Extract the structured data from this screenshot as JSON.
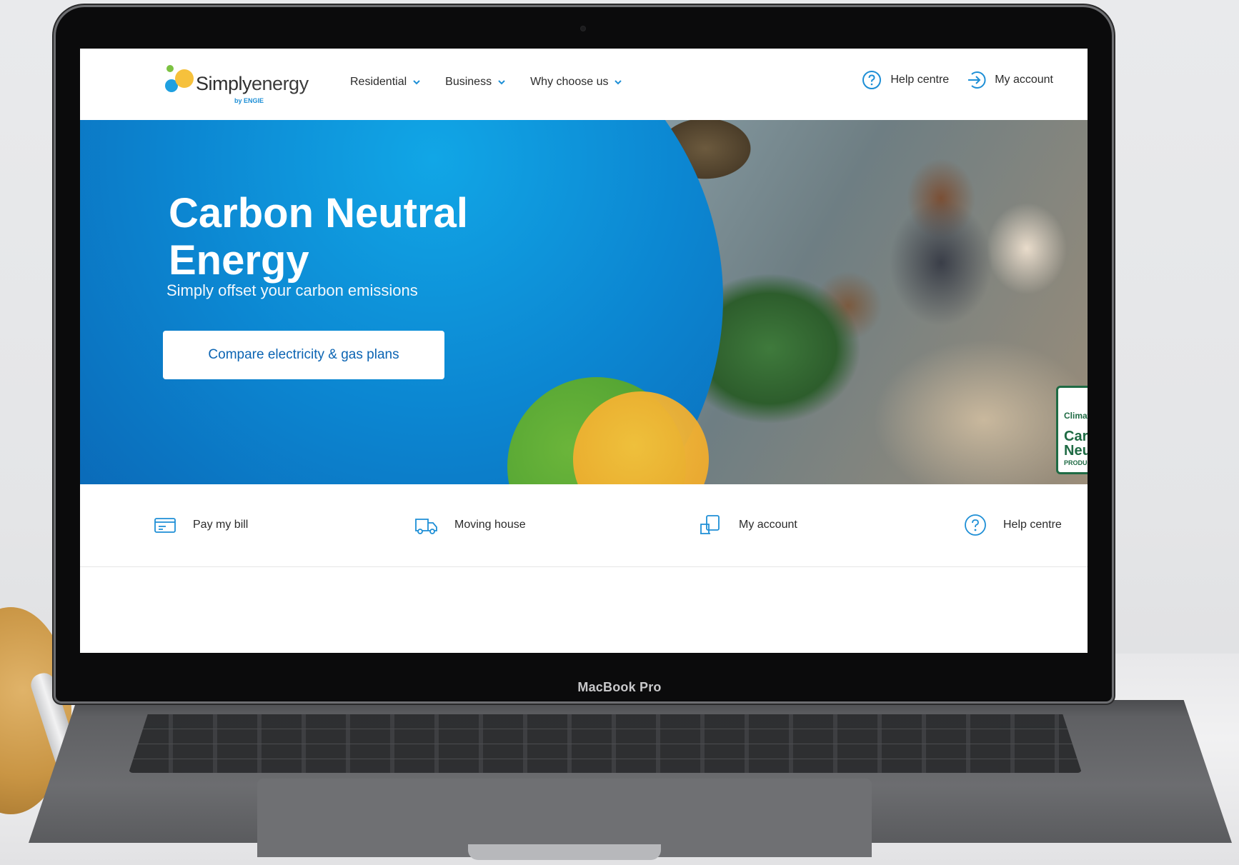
{
  "device": {
    "label": "MacBook Pro"
  },
  "logo": {
    "wordmark_bold": "Simply",
    "wordmark_light": "energy",
    "byline": "by ENGIE"
  },
  "nav": {
    "items": [
      {
        "label": "Residential"
      },
      {
        "label": "Business"
      },
      {
        "label": "Why choose us"
      }
    ]
  },
  "utility": {
    "help_label": "Help centre",
    "account_label": "My account"
  },
  "hero": {
    "title_line1": "Carbon Neutral",
    "title_line2": "Energy",
    "subtitle": "Simply offset your carbon emissions",
    "cta_label": "Compare electricity & gas plans",
    "badge": {
      "line1": "Climate",
      "line2": "Carb",
      "line3": "Neu",
      "line4": "PRODUC"
    }
  },
  "quick_links": [
    {
      "label": "Pay my bill",
      "icon": "bill-icon"
    },
    {
      "label": "Moving house",
      "icon": "truck-icon"
    },
    {
      "label": "My account",
      "icon": "laptop-icon"
    },
    {
      "label": "Help centre",
      "icon": "question-icon"
    }
  ],
  "colors": {
    "brand_blue": "#0a63b2",
    "accent_blue": "#11a6e6",
    "green": "#4c9f31",
    "yellow": "#efa629"
  }
}
